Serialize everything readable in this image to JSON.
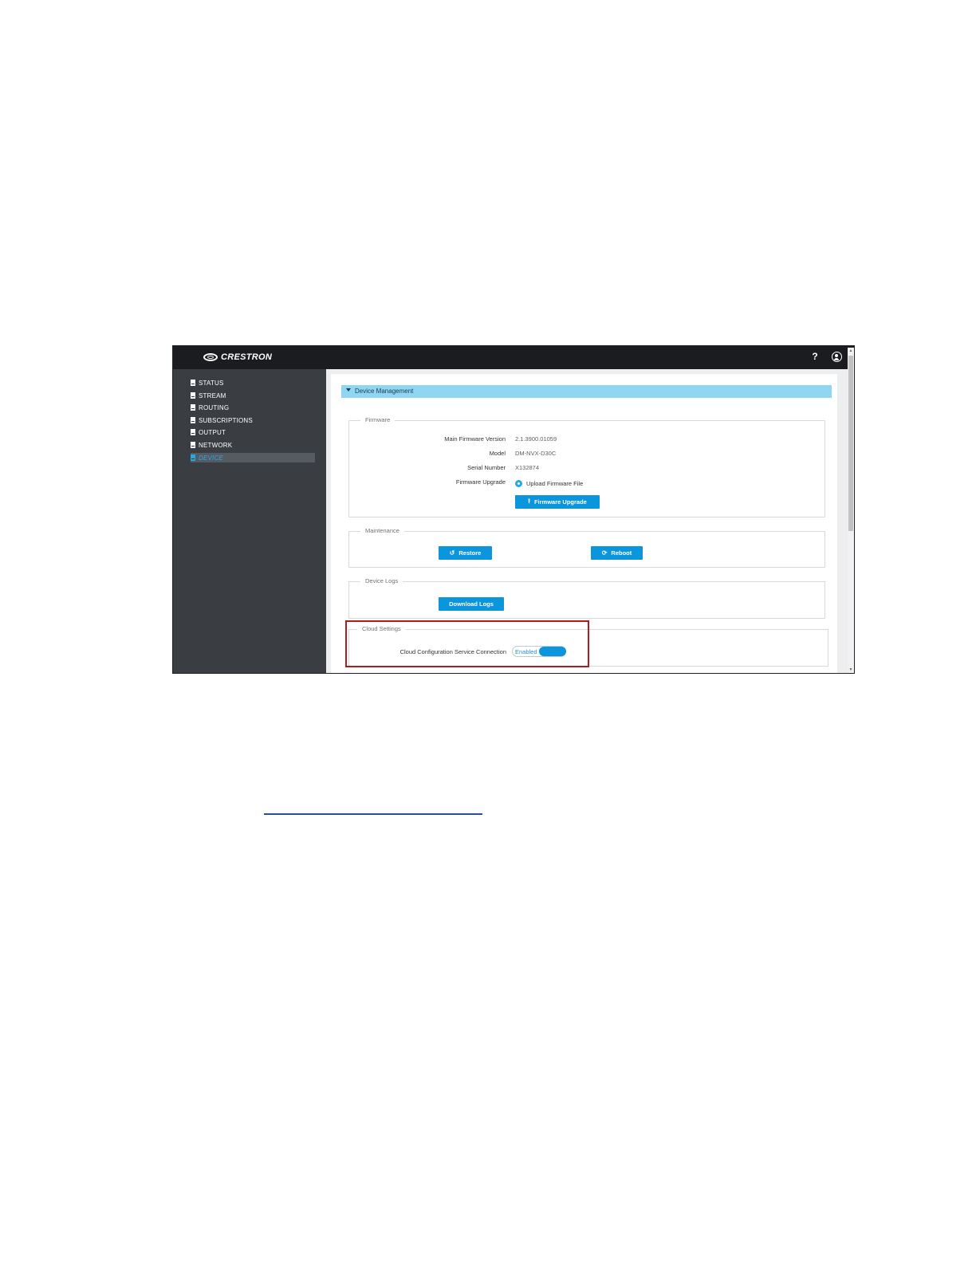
{
  "app": {
    "brand": "CRESTRON"
  },
  "topbar": {
    "help_icon": "question-icon",
    "help_glyph": "?",
    "user_icon": "user-circle-icon"
  },
  "sidebar": {
    "items": [
      {
        "label": "STATUS",
        "active": false
      },
      {
        "label": "STREAM",
        "active": false
      },
      {
        "label": "ROUTING",
        "active": false
      },
      {
        "label": "SUBSCRIPTIONS",
        "active": false
      },
      {
        "label": "OUTPUT",
        "active": false
      },
      {
        "label": "NETWORK",
        "active": false
      },
      {
        "label": "DEVICE",
        "active": true
      }
    ]
  },
  "device_management": {
    "title": "Device Management",
    "firmware": {
      "legend": "Firmware",
      "main_firmware_version_label": "Main Firmware Version",
      "main_firmware_version_value": "2.1.3900.01059",
      "model_label": "Model",
      "model_value": "DM-NVX-D30C",
      "serial_number_label": "Serial Number",
      "serial_number_value": "X132874",
      "firmware_upgrade_label": "Firmware Upgrade",
      "upload_option_label": "Upload Firmware File",
      "firmware_upgrade_button": "Firmware Upgrade"
    },
    "maintenance": {
      "legend": "Maintenance",
      "restore_button": "Restore",
      "reboot_button": "Reboot"
    },
    "device_logs": {
      "legend": "Device Logs",
      "download_button": "Download Logs"
    },
    "cloud_settings": {
      "legend": "Cloud Settings",
      "connection_label": "Cloud Configuration Service Connection",
      "toggle_label": "Enabled"
    }
  },
  "colors": {
    "accent": "#0b95dd",
    "header_bar": "#8fd6f3",
    "sidebar": "#3a3e43",
    "topbar": "#1a1c1f",
    "highlight_box": "#b3191d",
    "link": "#2b4c9a"
  }
}
